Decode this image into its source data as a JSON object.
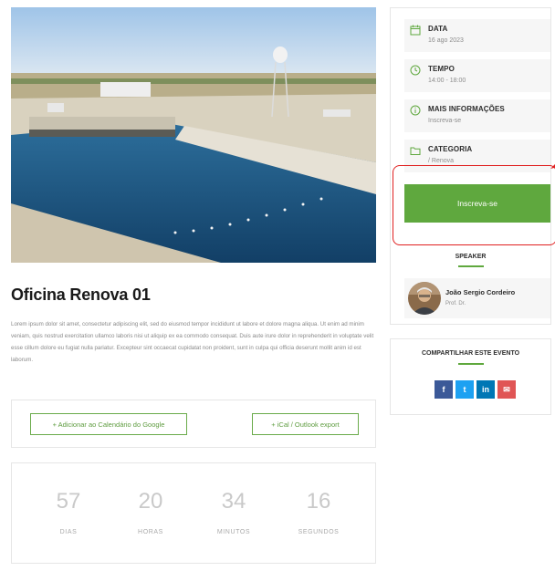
{
  "event": {
    "title": "Oficina Renova 01",
    "description": "Lorem ipsum dolor sit amet, consectetur adipiscing elit, sed do eiusmod tempor incididunt ut labore et dolore magna aliqua. Ut enim ad minim veniam, quis nostrud exercitation ullamco laboris nisi ut aliquip ex ea commodo consequat. Duis aute irure dolor in reprehenderit in voluptate velit esse cillum dolore eu fugiat nulla pariatur. Excepteur sint occaecat cupidatat non proident, sunt in culpa qui officia deserunt mollit anim id est laborum."
  },
  "calendar": {
    "google_label": "+ Adicionar ao Calendário do Google",
    "ical_label": "+ iCal / Outlook export"
  },
  "countdown": [
    {
      "value": "57",
      "label": "DIAS"
    },
    {
      "value": "20",
      "label": "HORAS"
    },
    {
      "value": "34",
      "label": "MINUTOS"
    },
    {
      "value": "16",
      "label": "SEGUNDOS"
    }
  ],
  "sidebar": {
    "items": [
      {
        "icon": "calendar-icon",
        "title": "DATA",
        "value": "16 ago 2023"
      },
      {
        "icon": "clock-icon",
        "title": "TEMPO",
        "value": "14:00 - 18:00"
      },
      {
        "icon": "info-icon",
        "title": "MAIS INFORMAÇÕES",
        "value": "Inscreva-se"
      },
      {
        "icon": "folder-icon",
        "title": "CATEGORIA",
        "value": "/ Renova"
      }
    ],
    "register_label": "Inscreva-se",
    "speaker_heading": "SPEAKER",
    "speaker": {
      "name": "João Sergio Cordeiro",
      "role": "Prof. Dr."
    }
  },
  "share": {
    "heading": "COMPARTILHAR ESTE EVENTO",
    "buttons": [
      {
        "icon": "facebook-icon",
        "glyph": "f",
        "color": "#3b5998"
      },
      {
        "icon": "twitter-icon",
        "glyph": "t",
        "color": "#1da1f2"
      },
      {
        "icon": "linkedin-icon",
        "glyph": "in",
        "color": "#0077b5"
      },
      {
        "icon": "email-icon",
        "glyph": "✉",
        "color": "#e05555"
      }
    ]
  },
  "colors": {
    "accent": "#5fa83e",
    "highlight": "#e02020"
  }
}
